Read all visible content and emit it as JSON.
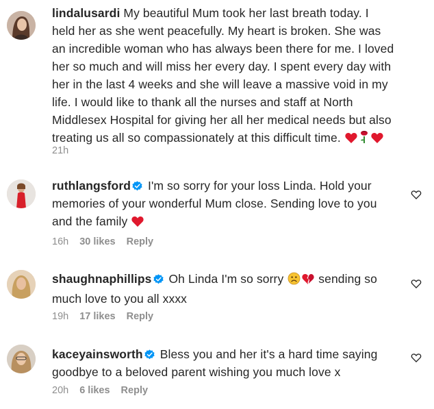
{
  "comments": [
    {
      "username": "lindalusardi",
      "verified": false,
      "text": "My beautiful Mum took her last breath today. I held her as she went peacefully. My heart is broken. She was an incredible woman who has always been there for me. I loved her so much and will miss her every day. I spent every day with her in the last 4 weeks and she will leave a massive void in my life. I would like to thank all the nurses and staff at North Middlesex Hospital for giving her all her medical needs but also treating us all so compassionately at this difficult time.",
      "emojis": [
        "red-heart",
        "rose",
        "red-heart"
      ],
      "time": "21h",
      "likes": "",
      "reply": ""
    },
    {
      "username": "ruthlangsford",
      "verified": true,
      "text": "I'm so sorry for your loss Linda. Hold your memories of your wonderful Mum close. Sending love to you and the family",
      "emojis": [
        "red-heart"
      ],
      "time": "16h",
      "likes": "30 likes",
      "reply": "Reply"
    },
    {
      "username": "shaughnaphillips",
      "verified": true,
      "text_before": "Oh Linda I'm so sorry",
      "emojis_mid": [
        "sad-face",
        "broken-heart"
      ],
      "text_after": "sending so much love to you all xxxx",
      "time": "19h",
      "likes": "17 likes",
      "reply": "Reply"
    },
    {
      "username": "kaceyainsworth",
      "verified": true,
      "text": "Bless you and her it's a hard time saying goodbye to a beloved parent wishing you much love x",
      "time": "20h",
      "likes": "6 likes",
      "reply": "Reply"
    }
  ],
  "colors": {
    "text": "#262626",
    "meta": "#8e8e8e",
    "verified": "#0095f6",
    "heart": "#e0182d"
  },
  "icons": {
    "like": "heart-outline-icon",
    "verified": "verified-badge-icon"
  }
}
